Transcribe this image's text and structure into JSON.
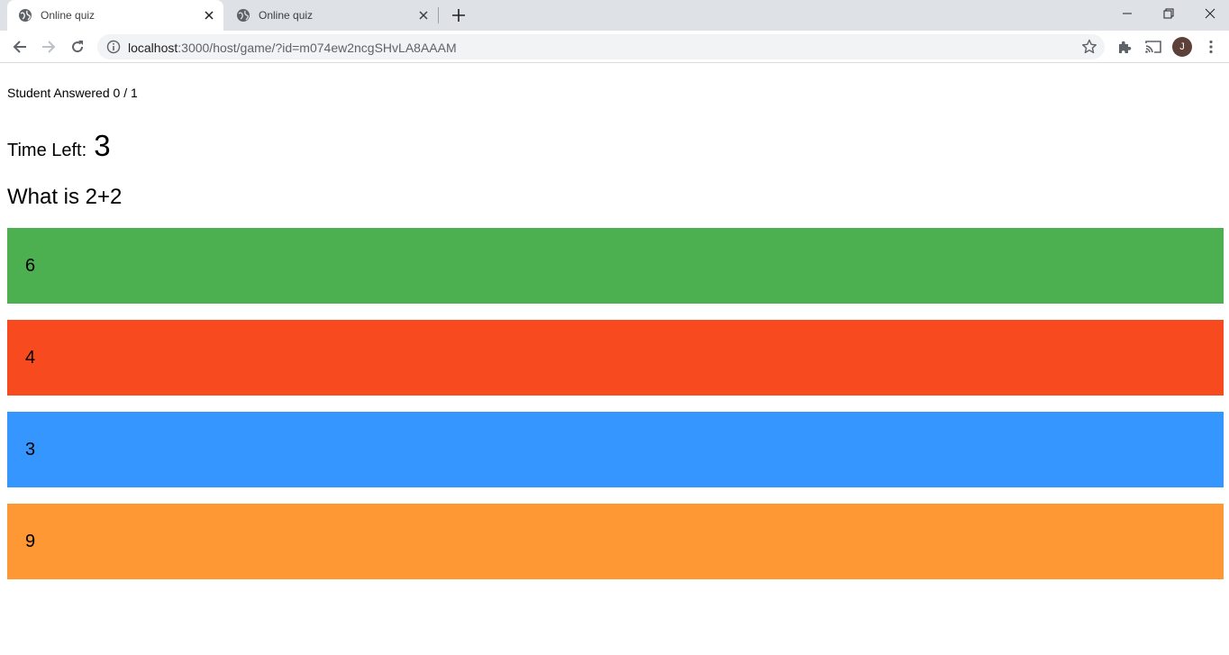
{
  "browser": {
    "tabs": [
      {
        "title": "Online quiz",
        "active": true
      },
      {
        "title": "Online quiz",
        "active": false
      }
    ],
    "address": {
      "host": "localhost",
      "path": ":3000/host/game/?id=m074ew2ncgSHvLA8AAAM"
    },
    "profile_initial": "J"
  },
  "quiz": {
    "answered_text": "Student Answered 0 / 1",
    "time_label": "Time Left:",
    "time_value": "3",
    "question": "What is 2+2",
    "answers": [
      {
        "label": "6",
        "color": "#4caf50"
      },
      {
        "label": "4",
        "color": "#f84a1f"
      },
      {
        "label": "3",
        "color": "#3496fe"
      },
      {
        "label": "9",
        "color": "#fe9834"
      }
    ]
  }
}
